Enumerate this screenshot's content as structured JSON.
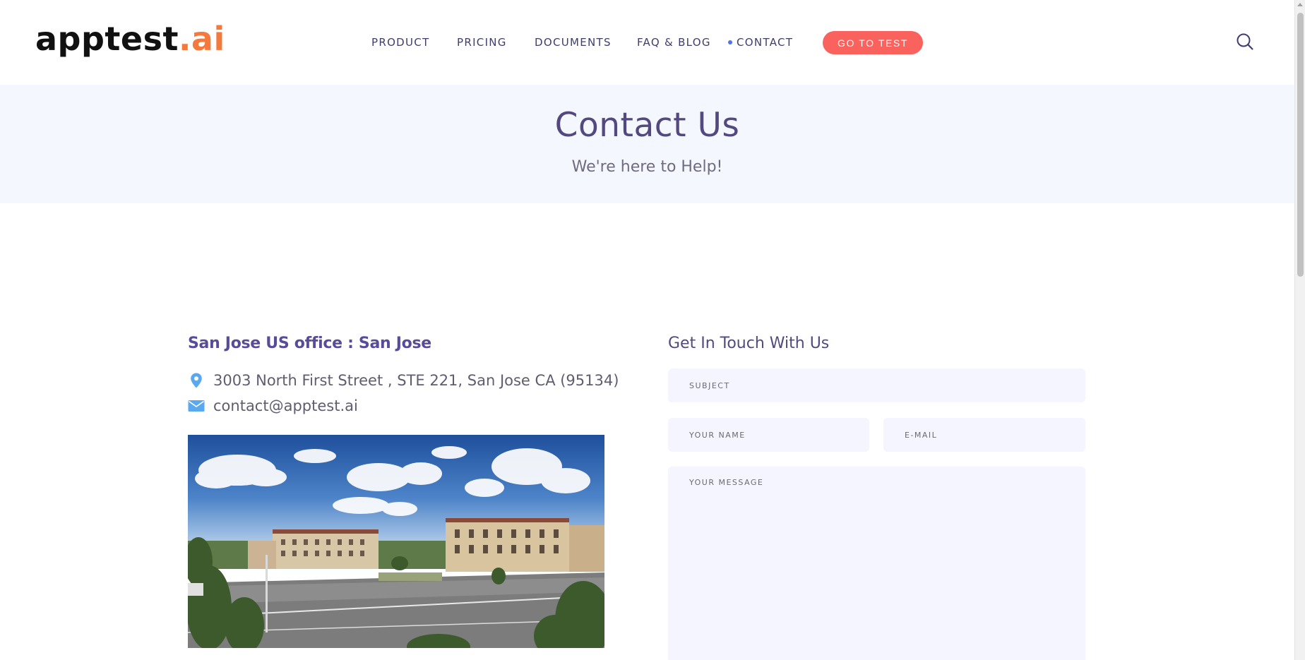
{
  "brand": {
    "logo_main": "apptest",
    "logo_accent": ".ai",
    "accent_color": "#f4793d"
  },
  "nav": {
    "items": [
      {
        "label": "PRODUCT"
      },
      {
        "label": "PRICING"
      },
      {
        "label": "DOCUMENTS"
      },
      {
        "label": "FAQ & BLOG"
      },
      {
        "label": "CONTACT",
        "active": true
      }
    ],
    "cta_label": "GO TO TEST",
    "cta_color": "#f9625d",
    "search_icon": "search-icon"
  },
  "hero": {
    "title": "Contact Us",
    "subtitle": "We're here to Help!"
  },
  "office": {
    "title": "San Jose US office : San Jose",
    "address": "3003 North First Street , STE 221, San Jose CA (95134)",
    "email": "contact@apptest.ai",
    "address_icon": "map-pin-icon",
    "email_icon": "envelope-icon"
  },
  "form": {
    "title": "Get In Touch With Us",
    "subject_placeholder": "SUBJECT",
    "name_placeholder": "YOUR NAME",
    "email_placeholder": "E-MAIL",
    "message_placeholder": "YOUR MESSAGE"
  }
}
